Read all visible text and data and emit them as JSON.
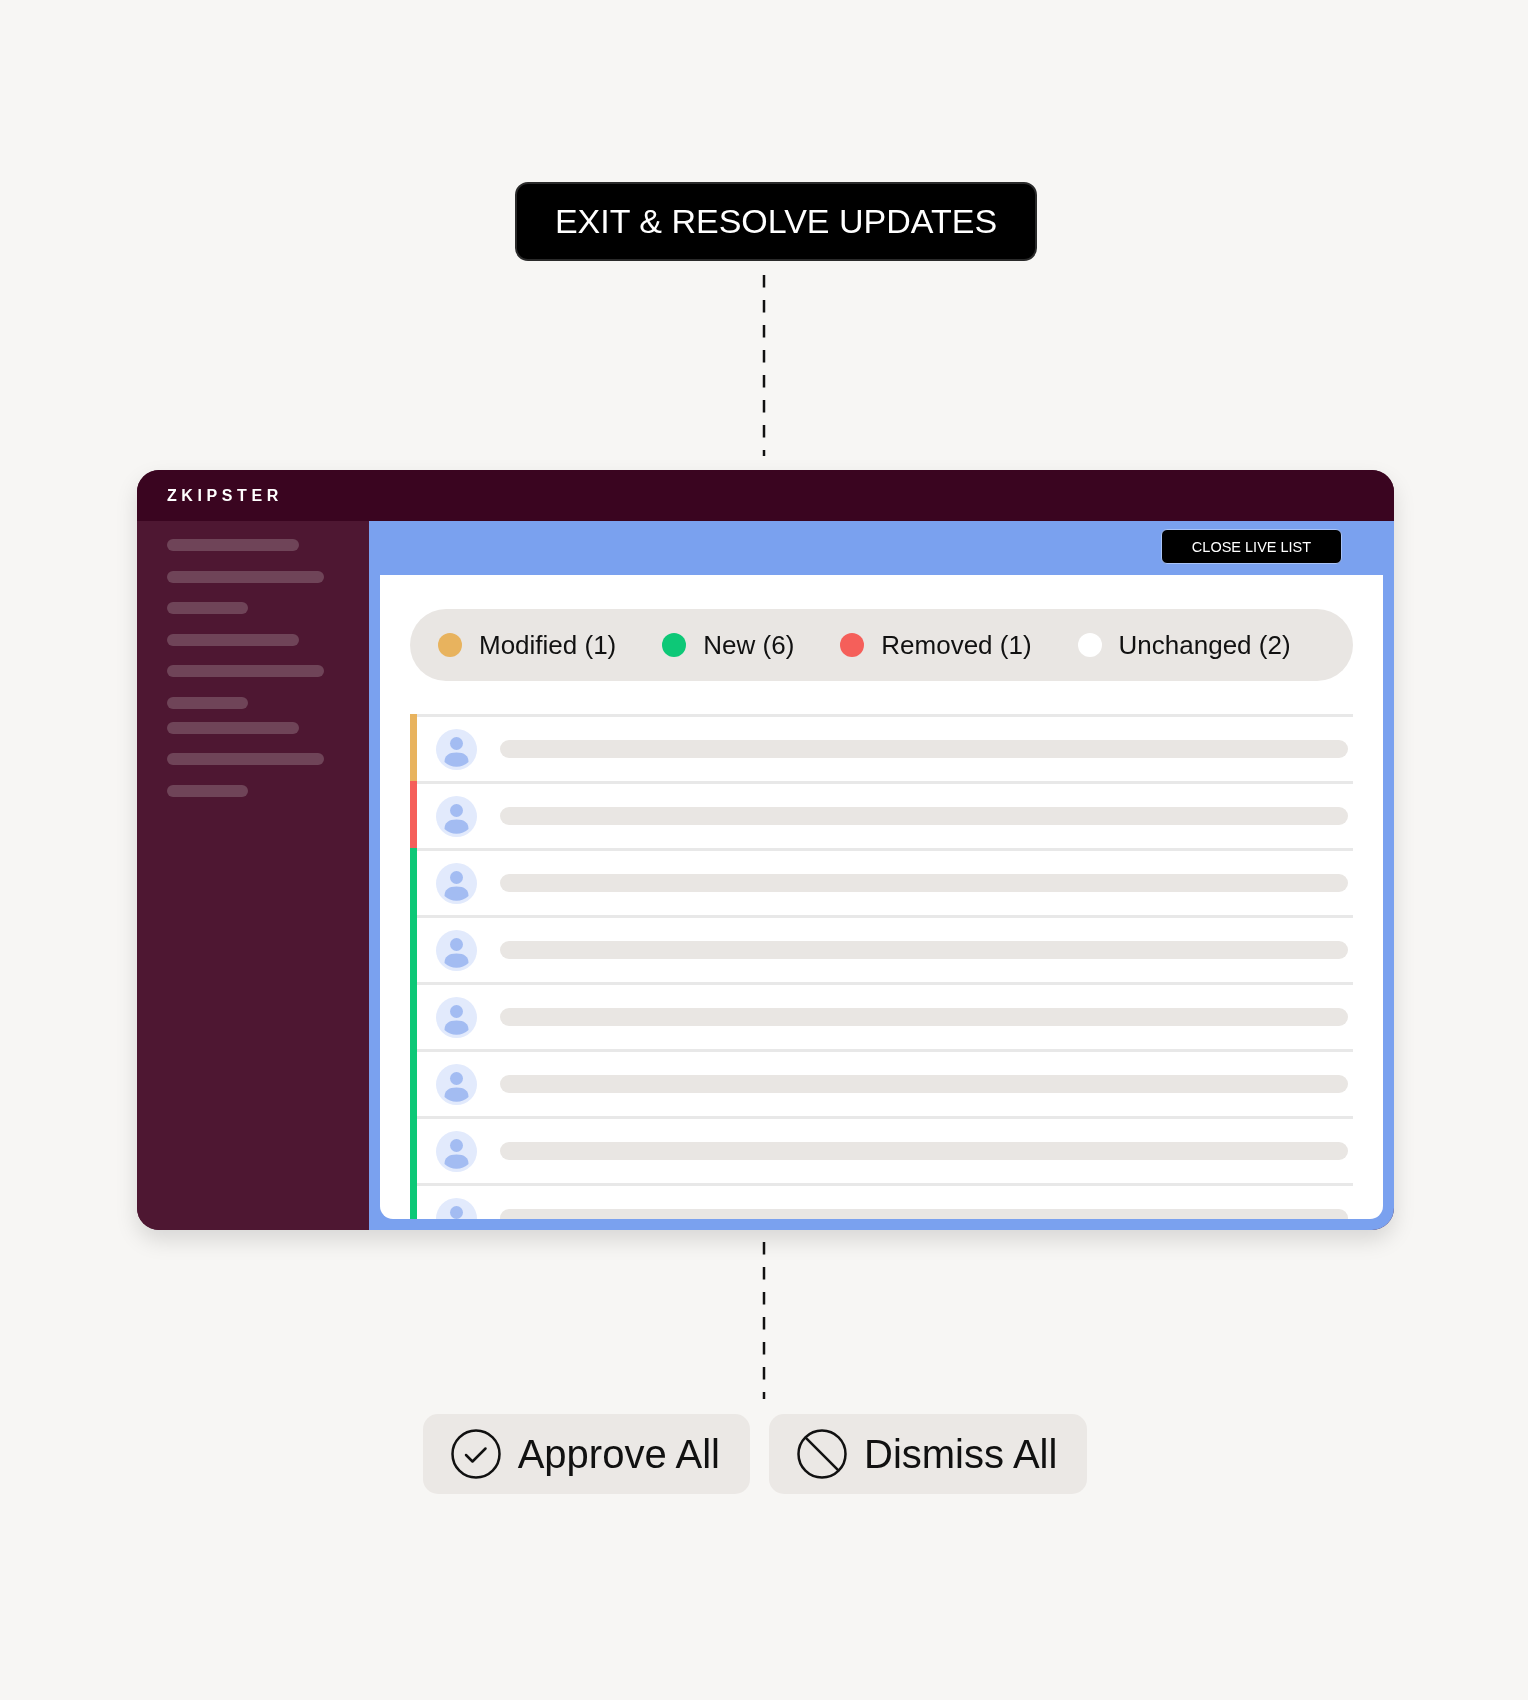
{
  "exit_button": {
    "label": "EXIT & RESOLVE UPDATES"
  },
  "window": {
    "logo": "ZKIPSTER",
    "close_button": {
      "label": "CLOSE LIVE LIST"
    },
    "legend": [
      {
        "label": "Modified (1)",
        "color": "#e8b35e"
      },
      {
        "label": "New (6)",
        "color": "#0dc877"
      },
      {
        "label": "Removed (1)",
        "color": "#f55f5a"
      },
      {
        "label": "Unchanged (2)",
        "color": "#ffffff"
      }
    ],
    "rows": [
      {
        "color": "#e8b35e"
      },
      {
        "color": "#f55f5a"
      },
      {
        "color": "#0dc877"
      },
      {
        "color": "#0dc877"
      },
      {
        "color": "#0dc877"
      },
      {
        "color": "#0dc877"
      },
      {
        "color": "#0dc877"
      },
      {
        "color": "#0dc877"
      }
    ]
  },
  "actions": [
    {
      "label": "Approve All",
      "kind": "approve"
    },
    {
      "label": "Dismiss All",
      "kind": "dismiss"
    }
  ]
}
